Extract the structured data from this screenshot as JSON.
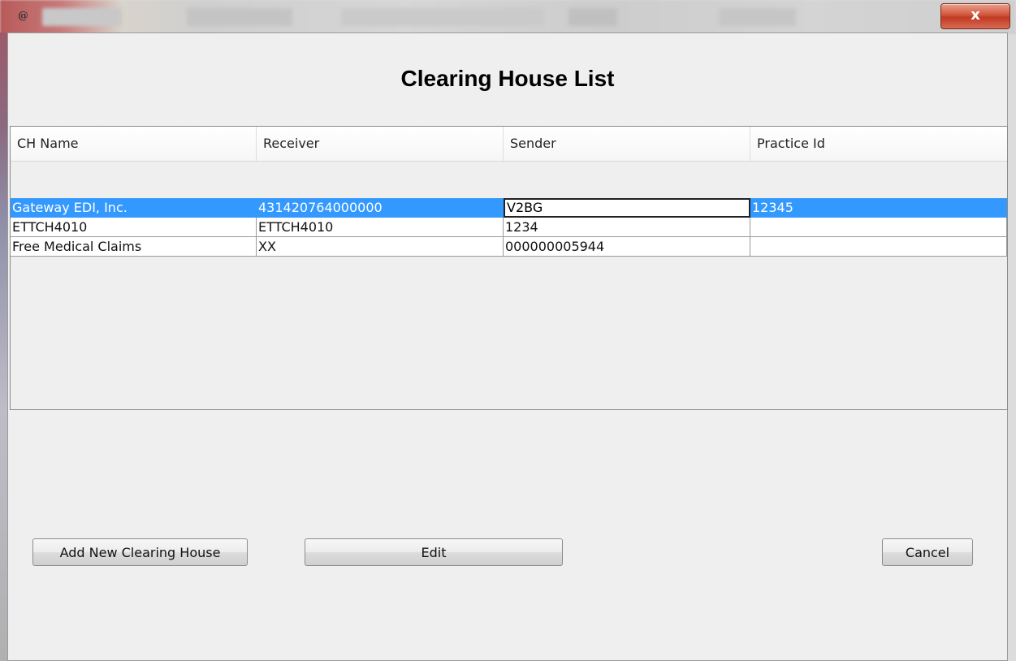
{
  "window": {
    "app_icon": "@",
    "close_label": "x"
  },
  "dialog": {
    "title": "Clearing House List"
  },
  "table": {
    "columns": [
      "CH Name",
      "Receiver",
      "Sender",
      "Practice Id"
    ],
    "rows": [
      [
        "Gateway EDI, Inc.",
        "431420764000000",
        "V2BG",
        "12345"
      ],
      [
        "ETTCH4010",
        "ETTCH4010",
        "1234",
        ""
      ],
      [
        "Free Medical Claims",
        "XX",
        "000000005944",
        ""
      ]
    ],
    "selected_row": 0,
    "editing_cell": {
      "row": 0,
      "col": 2
    }
  },
  "buttons": {
    "add": "Add New Clearing House",
    "edit": "Edit",
    "cancel": "Cancel"
  }
}
